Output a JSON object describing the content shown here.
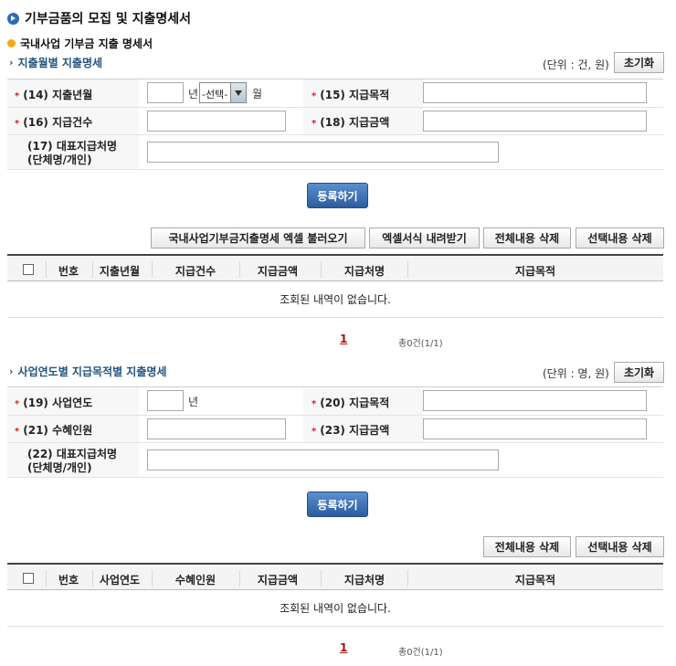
{
  "page": {
    "title": "기부금품의 모집 및 지출명세서",
    "subtitle": "국내사업 기부금 지출 명세서"
  },
  "section1": {
    "heading": "지출월별 지출명세",
    "unit": "(단위 : 건, 원)",
    "reset_label": "초기화",
    "fields": {
      "f14": "(14) 지출년월",
      "f15": "(15) 지급목적",
      "f16": "(16) 지급건수",
      "f18": "(18) 지급금액",
      "f17_line1": "(17) 대표지급처명",
      "f17_line2": "(단체명/개인)"
    },
    "year_suffix": "년",
    "month_select": "-선택-",
    "month_suffix": "월",
    "register_label": "등록하기",
    "actions": {
      "import_excel": "국내사업기부금지출명세 엑셀 불러오기",
      "download_excel": "엑셀서식 내려받기",
      "delete_all": "전체내용 삭제",
      "delete_selected": "선택내용 삭제"
    },
    "columns": [
      "번호",
      "지출년월",
      "지급건수",
      "지급금액",
      "지급처명",
      "지급목적"
    ],
    "empty_message": "조회된 내역이 없습니다.",
    "page_number": "1",
    "total": "총0건(1/1)"
  },
  "section2": {
    "heading": "사업연도별 지급목적별 지출명세",
    "unit": "(단위 : 명, 원)",
    "reset_label": "초기화",
    "fields": {
      "f19": "(19) 사업연도",
      "f20": "(20) 지급목적",
      "f21": "(21) 수혜인원",
      "f23": "(23) 지급금액",
      "f22_line1": "(22) 대표지급처명",
      "f22_line2": "(단체명/개인)"
    },
    "year_suffix": "년",
    "register_label": "등록하기",
    "actions": {
      "delete_all": "전체내용 삭제",
      "delete_selected": "선택내용 삭제"
    },
    "columns": [
      "번호",
      "사업연도",
      "수혜인원",
      "지급금액",
      "지급처명",
      "지급목적"
    ],
    "empty_message": "조회된 내역이 없습니다.",
    "page_number": "1",
    "total": "총0건(1/1)"
  }
}
